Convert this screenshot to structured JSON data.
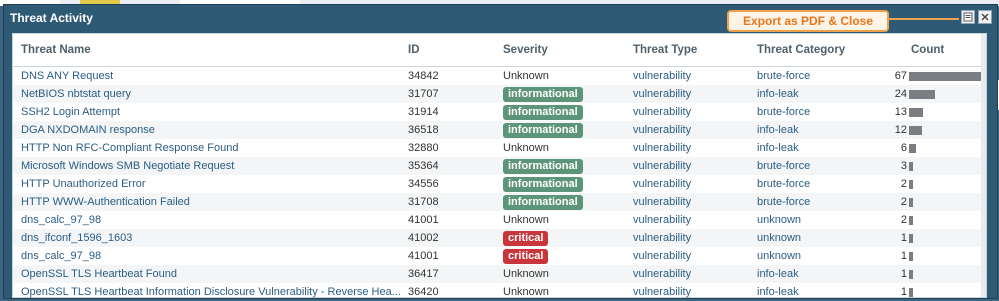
{
  "window": {
    "title": "Threat Activity"
  },
  "toolbar": {
    "export_tooltip": "Export as PDF & Close"
  },
  "table": {
    "headers": [
      "Threat Name",
      "ID",
      "Severity",
      "Threat Type",
      "Threat Category",
      "Count"
    ],
    "rows": [
      {
        "name": "DNS ANY Request",
        "id": "34842",
        "severity": "Unknown",
        "type": "vulnerability",
        "category": "brute-force",
        "count": 67
      },
      {
        "name": "NetBIOS nbtstat query",
        "id": "31707",
        "severity": "informational",
        "type": "vulnerability",
        "category": "info-leak",
        "count": 24
      },
      {
        "name": "SSH2 Login Attempt",
        "id": "31914",
        "severity": "informational",
        "type": "vulnerability",
        "category": "brute-force",
        "count": 13
      },
      {
        "name": "DGA NXDOMAIN response",
        "id": "36518",
        "severity": "informational",
        "type": "vulnerability",
        "category": "info-leak",
        "count": 12
      },
      {
        "name": "HTTP Non RFC-Compliant Response Found",
        "id": "32880",
        "severity": "Unknown",
        "type": "vulnerability",
        "category": "info-leak",
        "count": 6
      },
      {
        "name": "Microsoft Windows SMB Negotiate Request",
        "id": "35364",
        "severity": "informational",
        "type": "vulnerability",
        "category": "brute-force",
        "count": 3
      },
      {
        "name": "HTTP Unauthorized Error",
        "id": "34556",
        "severity": "informational",
        "type": "vulnerability",
        "category": "brute-force",
        "count": 2
      },
      {
        "name": "HTTP WWW-Authentication Failed",
        "id": "31708",
        "severity": "informational",
        "type": "vulnerability",
        "category": "brute-force",
        "count": 2
      },
      {
        "name": "dns_calc_97_98",
        "id": "41001",
        "severity": "Unknown",
        "type": "vulnerability",
        "category": "unknown",
        "count": 2
      },
      {
        "name": "dns_ifconf_1596_1603",
        "id": "41002",
        "severity": "critical",
        "type": "vulnerability",
        "category": "unknown",
        "count": 1
      },
      {
        "name": "dns_calc_97_98",
        "id": "41001",
        "severity": "critical",
        "type": "vulnerability",
        "category": "unknown",
        "count": 1
      },
      {
        "name": "OpenSSL TLS Heartbeat Found",
        "id": "36417",
        "severity": "Unknown",
        "type": "vulnerability",
        "category": "info-leak",
        "count": 1
      },
      {
        "name": "OpenSSL TLS Heartbeat Information Disclosure Vulnerability - Reverse Hea...",
        "id": "36420",
        "severity": "Unknown",
        "type": "vulnerability",
        "category": "info-leak",
        "count": 1
      }
    ]
  },
  "colors": {
    "informational": "#5c9579",
    "critical": "#c8363b",
    "callout": "#f0a24b",
    "link": "#2b5d84",
    "bar": "#7a7e82"
  },
  "icons": [
    "pdf-export-icon",
    "close-icon"
  ]
}
